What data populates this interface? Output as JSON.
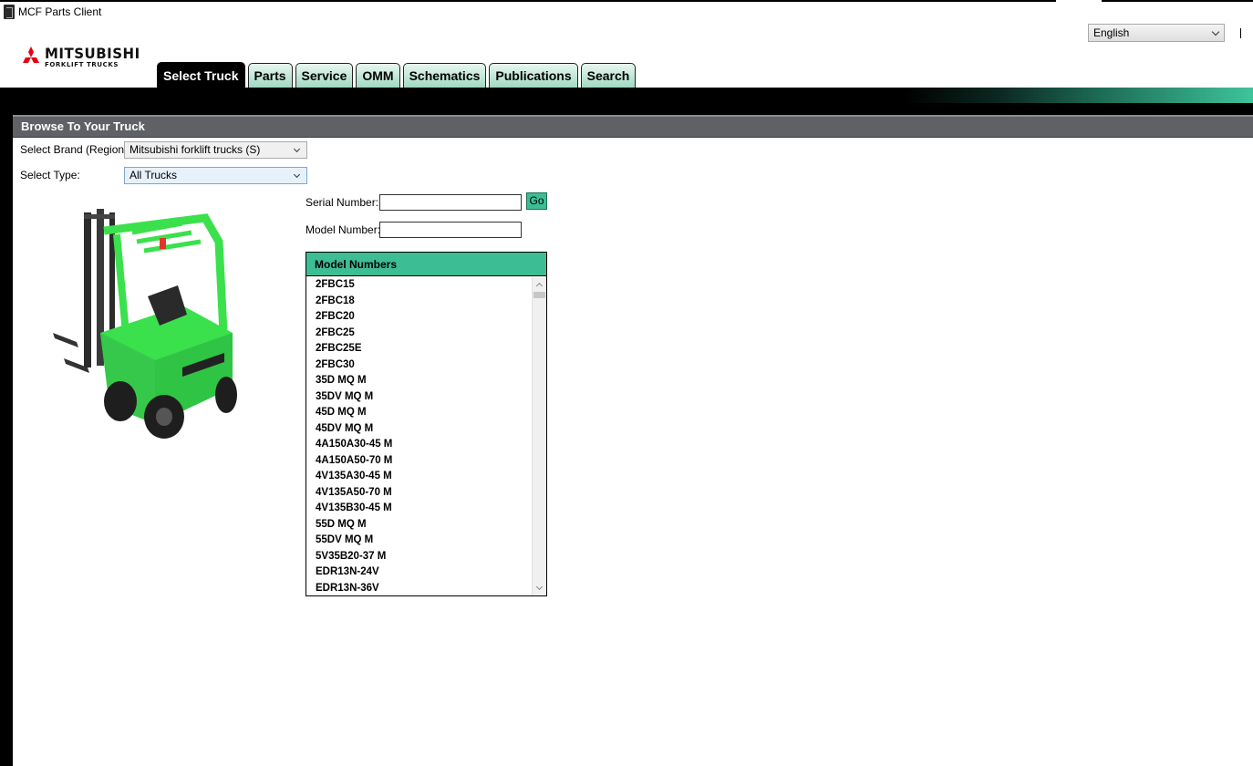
{
  "window": {
    "title": "MCF Parts Client"
  },
  "language": {
    "selected": "English"
  },
  "logo": {
    "main": "MITSUBISHI",
    "sub": "FORKLIFT TRUCKS"
  },
  "tabs": [
    {
      "label": "Select Truck",
      "active": true
    },
    {
      "label": "Parts"
    },
    {
      "label": "Service"
    },
    {
      "label": "OMM"
    },
    {
      "label": "Schematics"
    },
    {
      "label": "Publications"
    },
    {
      "label": "Search"
    }
  ],
  "panel": {
    "title": "Browse To Your Truck",
    "brand_label": "Select Brand (Region):",
    "brand_value": "Mitsubishi forklift trucks (S)",
    "type_label": "Select Type:",
    "type_value": "All Trucks",
    "serial_label": "Serial Number:",
    "serial_value": "",
    "go_label": "Go",
    "model_label": "Model Number:",
    "model_value": ""
  },
  "models": {
    "header": "Model Numbers",
    "items": [
      "2FBC15",
      "2FBC18",
      "2FBC20",
      "2FBC25",
      "2FBC25E",
      "2FBC30",
      "35D MQ M",
      "35DV MQ M",
      "45D MQ M",
      "45DV MQ M",
      "4A150A30-45 M",
      "4A150A50-70 M",
      "4V135A30-45 M",
      "4V135A50-70 M",
      "4V135B30-45 M",
      "55D MQ M",
      "55DV MQ M",
      "5V35B20-37 M",
      "EDR13N-24V",
      "EDR13N-36V"
    ]
  },
  "colors": {
    "accent": "#3dbd94",
    "header": "#5f6167",
    "brand_red": "#e60012"
  }
}
